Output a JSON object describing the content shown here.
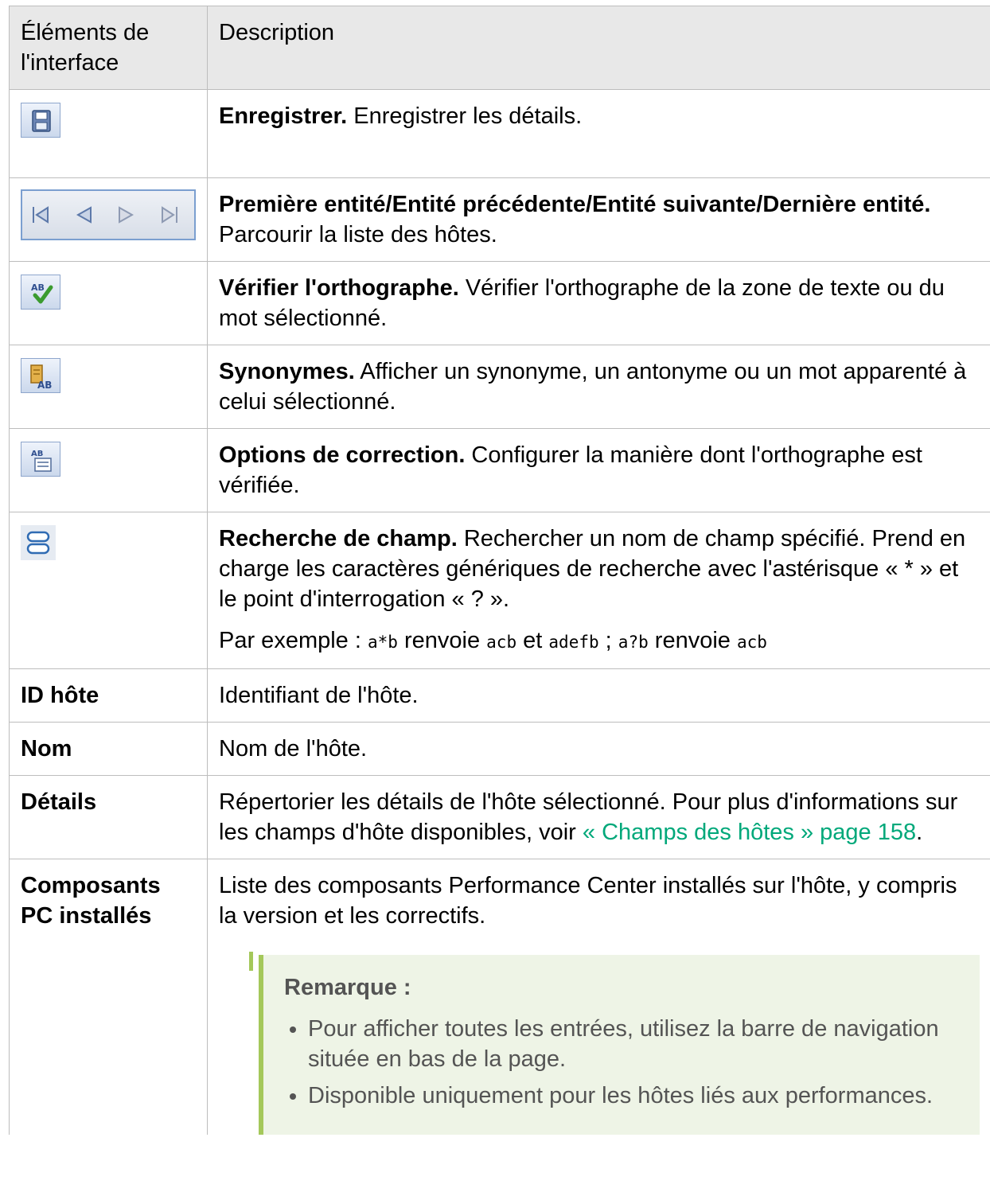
{
  "table": {
    "header": {
      "col1": "Éléments de l'interface",
      "col2": "Description"
    },
    "rows": {
      "save": {
        "icon": "save-icon",
        "title": "Enregistrer.",
        "text": " Enregistrer les détails."
      },
      "navigation": {
        "icons": [
          "first-entity-icon",
          "previous-entity-icon",
          "next-entity-icon",
          "last-entity-icon"
        ],
        "title": "Première entité/Entité précédente/Entité suivante/Dernière entité.",
        "text": "Parcourir la liste des hôtes."
      },
      "spell_check": {
        "icon": "spell-check-icon",
        "title": "Vérifier l'orthographe.",
        "text": " Vérifier l'orthographe de la zone de texte ou du mot sélectionné."
      },
      "thesaurus": {
        "icon": "thesaurus-icon",
        "title": "Synonymes.",
        "text": " Afficher un synonyme, un antonyme ou un mot apparenté à celui sélectionné."
      },
      "spelling_options": {
        "icon": "spelling-options-icon",
        "title": "Options de correction.",
        "text": " Configurer la manière dont l'orthographe est vérifiée."
      },
      "field_search": {
        "icon": "field-search-icon",
        "title": "Recherche de champ.",
        "text": " Rechercher un nom de champ spécifié. Prend en charge les caractères génériques de recherche avec l'astérisque « * » et le point d'interrogation « ? ».",
        "example_prefix": "Par exemple : ",
        "code1": "a*b",
        "word_renvoie1": " renvoie ",
        "code2": "acb",
        "word_et": " et ",
        "code3": "adefb",
        "separator": " ; ",
        "code4": "a?b",
        "word_renvoie2": " renvoie ",
        "code5": "acb"
      },
      "host_id": {
        "label": "ID hôte",
        "text": "Identifiant de l'hôte."
      },
      "name": {
        "label": "Nom",
        "text": "Nom de l'hôte."
      },
      "details": {
        "label": "Détails",
        "text": "Répertorier les détails de l'hôte sélectionné. Pour plus d'informations sur les champs d'hôte disponibles, voir ",
        "link": "« Champs des hôtes » page 158",
        "end": "."
      },
      "pc_components": {
        "label": "Composants PC installés",
        "text": "Liste des composants Performance Center installés sur l'hôte, y compris la version et les correctifs.",
        "note": {
          "title": "Remarque :",
          "items": [
            "Pour afficher toutes les entrées, utilisez la barre de navigation située en bas de la page.",
            "Disponible uniquement pour les hôtes liés aux performances."
          ]
        }
      }
    }
  },
  "colors": {
    "header_bg": "#e8e8e8",
    "border": "#bdbdbd",
    "link": "#00a87a",
    "note_bg": "#eef4e6",
    "note_accent": "#a4c85a"
  }
}
